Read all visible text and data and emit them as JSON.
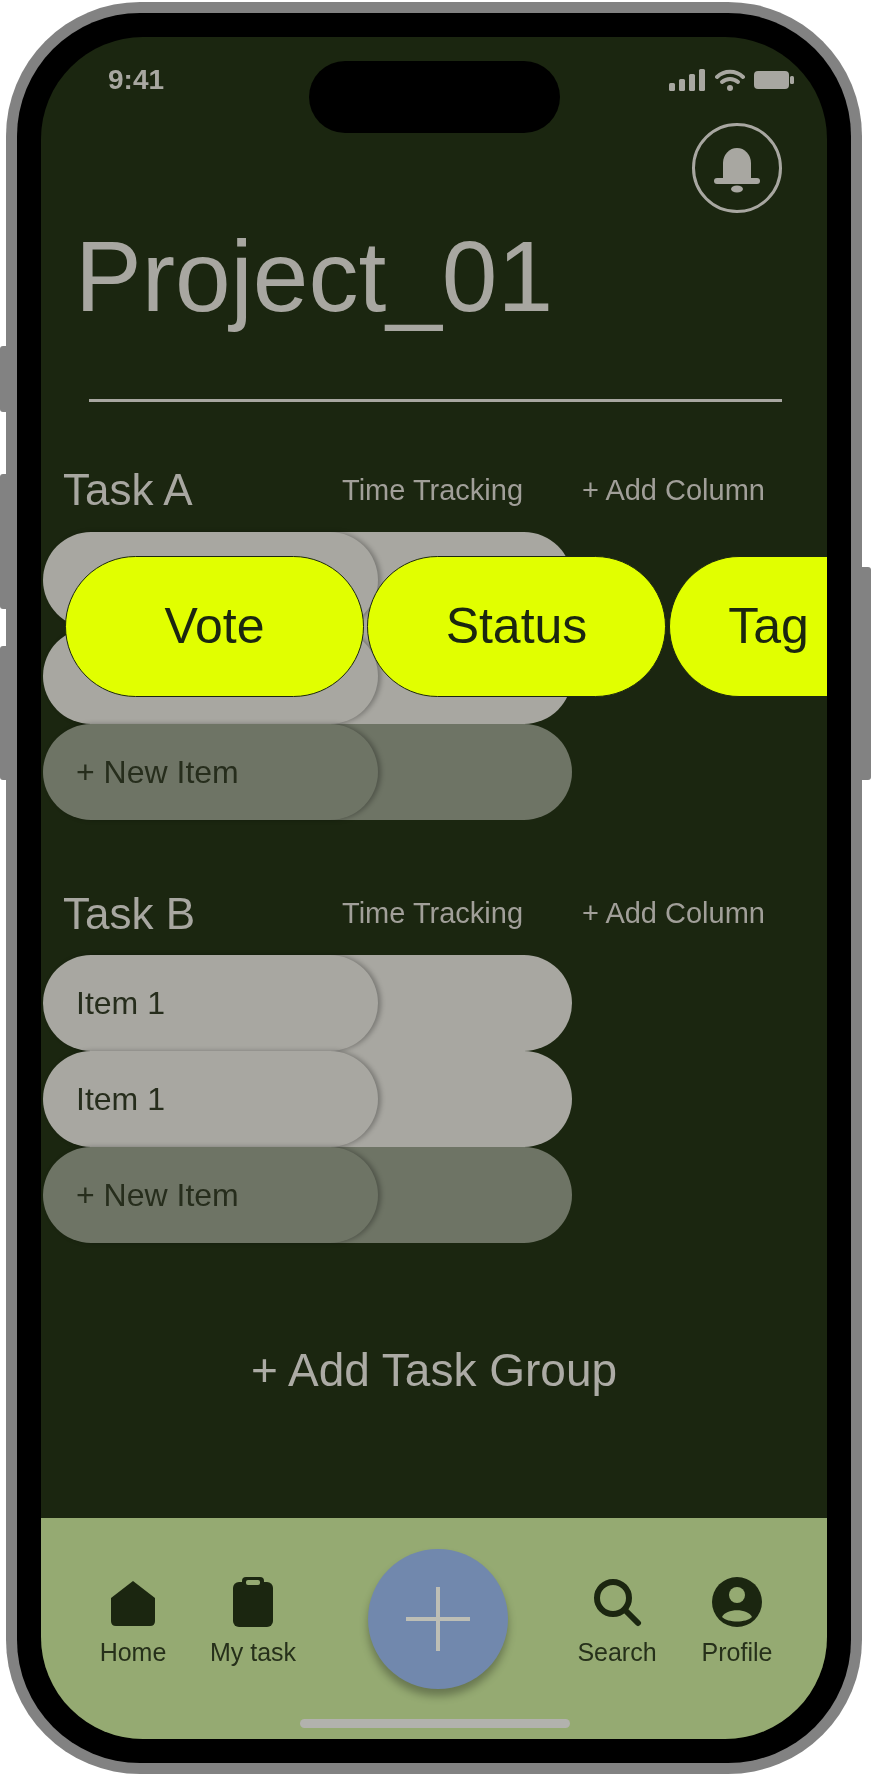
{
  "status_bar": {
    "time": "9:41"
  },
  "title": "Project_01",
  "groups": [
    {
      "title": "Task A",
      "column_header": "Time Tracking",
      "add_column": "+ Add Column",
      "items": [
        {
          "kind": "item"
        },
        {
          "kind": "item"
        },
        {
          "kind": "add",
          "label": "+ New Item"
        }
      ],
      "column_picker": {
        "options": [
          {
            "label": "Vote"
          },
          {
            "label": "Status"
          },
          {
            "label": "Tag"
          }
        ]
      }
    },
    {
      "title": "Task B",
      "column_header": "Time Tracking",
      "add_column": "+ Add Column",
      "items": [
        {
          "kind": "item",
          "label": "Item 1"
        },
        {
          "kind": "item",
          "label": "Item 1"
        },
        {
          "kind": "add",
          "label": "+ New Item"
        }
      ]
    }
  ],
  "add_group": "+ Add Task Group",
  "nav": {
    "items": [
      {
        "kind": "home",
        "label": "Home"
      },
      {
        "kind": "tasks",
        "label": "My task"
      },
      {
        "kind": "add"
      },
      {
        "kind": "search",
        "label": "Search"
      },
      {
        "kind": "profile",
        "label": "Profile"
      }
    ]
  }
}
